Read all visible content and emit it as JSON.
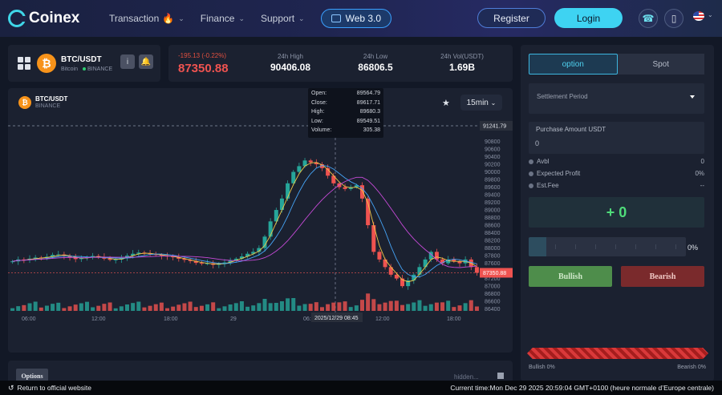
{
  "header": {
    "brand": "Coinex",
    "nav": [
      {
        "label": "Transaction"
      },
      {
        "label": "Finance"
      },
      {
        "label": "Support"
      }
    ],
    "web3_label": "Web 3.0",
    "register_label": "Register",
    "login_label": "Login"
  },
  "pair": {
    "symbol": "BTC/USDT",
    "coin": "Bitcoin",
    "exchange": "BINANCE",
    "info_label": "i"
  },
  "stats": {
    "change": "-195.13 (-0.22%)",
    "last_price": "87350.88",
    "high_label": "24h High",
    "high_value": "90406.08",
    "low_label": "24h Low",
    "low_value": "86806.5",
    "vol_label": "24h Vol(USDT)",
    "vol_value": "1.69B"
  },
  "chart_header": {
    "symbol": "BTC/USDT",
    "exchange": "BINANCE",
    "interval": "15min"
  },
  "tooltip": {
    "rows": [
      {
        "k": "Open:",
        "v": "89564.79"
      },
      {
        "k": "Close:",
        "v": "89617.71"
      },
      {
        "k": "High:",
        "v": "89680.3"
      },
      {
        "k": "Low:",
        "v": "89549.51"
      },
      {
        "k": "Volume:",
        "v": "305.38"
      }
    ],
    "time_label": "2025/12/29 08:45"
  },
  "colors": {
    "up": "#26a69a",
    "down": "#ef5350",
    "ma_fast": "#f0c948",
    "ma_mid": "#45a3f5",
    "ma_slow": "#c74ad8",
    "accent": "#3ed3f2"
  },
  "chart_data": {
    "type": "candlestick",
    "x_ticks": [
      "06:00",
      "12:00",
      "18:00",
      "29",
      "06:00",
      "12:00",
      "18:00"
    ],
    "y_ticks": [
      86400,
      86600,
      86800,
      87000,
      87200,
      87400,
      87600,
      87800,
      88000,
      88200,
      88400,
      88600,
      88800,
      89000,
      89200,
      89400,
      89600,
      89800,
      90000,
      90200,
      90400,
      90600,
      90800
    ],
    "ylim": [
      86350,
      91400
    ],
    "crosshair_price": "91241.79",
    "last_price_label": "87350.88",
    "price_path": [
      87650,
      87700,
      87690,
      87720,
      87750,
      87740,
      87770,
      87820,
      87830,
      87800,
      87760,
      87710,
      87740,
      87760,
      87790,
      87770,
      87720,
      87690,
      87700,
      87740,
      87800,
      87850,
      87880,
      87860,
      87840,
      87820,
      87800,
      87780,
      87760,
      87720,
      87690,
      87660,
      87610,
      87590,
      87600,
      87560,
      87580,
      87620,
      87680,
      87720,
      87780,
      87850,
      87900,
      88000,
      88300,
      88700,
      89000,
      89300,
      89700,
      90000,
      90150,
      90300,
      90250,
      90200,
      90100,
      89900,
      89700,
      89600,
      89550,
      89600,
      89650,
      89300,
      88600,
      87900,
      87700,
      87500,
      87300,
      87200,
      87000,
      87150,
      87300,
      87500,
      87700,
      87900,
      87700,
      87600,
      87700,
      87650,
      87600,
      87700,
      87500,
      87350
    ]
  },
  "trade": {
    "tab_option": "option",
    "tab_spot": "Spot",
    "settlement_placeholder": "Settlement Period",
    "amount_label": "Purchase Amount USDT",
    "amount_value": "0",
    "avbl_label": "Avbl",
    "avbl_value": "0",
    "profit_label": "Expected Profit",
    "profit_value": "0%",
    "fee_label": "Est.Fee",
    "fee_value": "--",
    "profit_display": "+ 0",
    "slider_value": 0.11,
    "slider_pct": "0%",
    "bullish_label": "Bullish",
    "bearish_label": "Bearish",
    "bullish_pct": "Bullish 0%",
    "bearish_pct": "Bearish 0%"
  },
  "options_panel": {
    "tab_label": "Options",
    "hidden_label": "hidden..."
  },
  "footer": {
    "return_label": "Return to official website",
    "time_text": "Current time:Mon Dec 29 2025 20:59:04 GMT+0100 (heure normale d’Europe centrale)"
  }
}
